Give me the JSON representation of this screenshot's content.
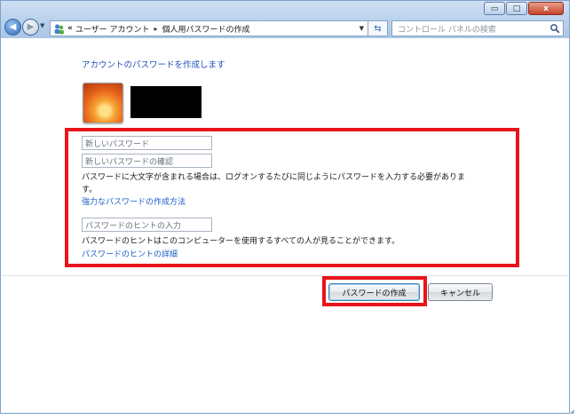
{
  "window": {
    "caption_buttons": {
      "minimize": "▭",
      "maximize": "□",
      "close": "x"
    }
  },
  "address_bar": {
    "chevron": "«",
    "breadcrumb": [
      "ユーザー アカウント",
      "個人用パスワードの作成"
    ],
    "separator": "▸",
    "icon": "user-accounts-icon"
  },
  "search": {
    "placeholder": "コントロール パネルの検索",
    "icon": "search-icon"
  },
  "content": {
    "heading": "アカウントのパスワードを作成します",
    "user_name_redacted": "",
    "new_password_placeholder": "新しいパスワード",
    "confirm_password_placeholder": "新しいパスワードの確認",
    "case_warning_line1": "パスワードに大文字が含まれる場合は、ログオンするたびに同じようにパスワードを入力する必要がありま",
    "case_warning_line2": "す。",
    "strong_password_link": "強力なパスワードの作成方法",
    "hint_placeholder": "パスワードのヒントの入力",
    "hint_notice": "パスワードのヒントはこのコンピューターを使用するすべての人が見ることができます。",
    "hint_details_link": "パスワードのヒントの詳細"
  },
  "buttons": {
    "create": "パスワードの作成",
    "cancel": "キャンセル"
  },
  "colors": {
    "highlight": "#e8141b",
    "link": "#1a5ec9",
    "heading": "#1f4fbf"
  }
}
